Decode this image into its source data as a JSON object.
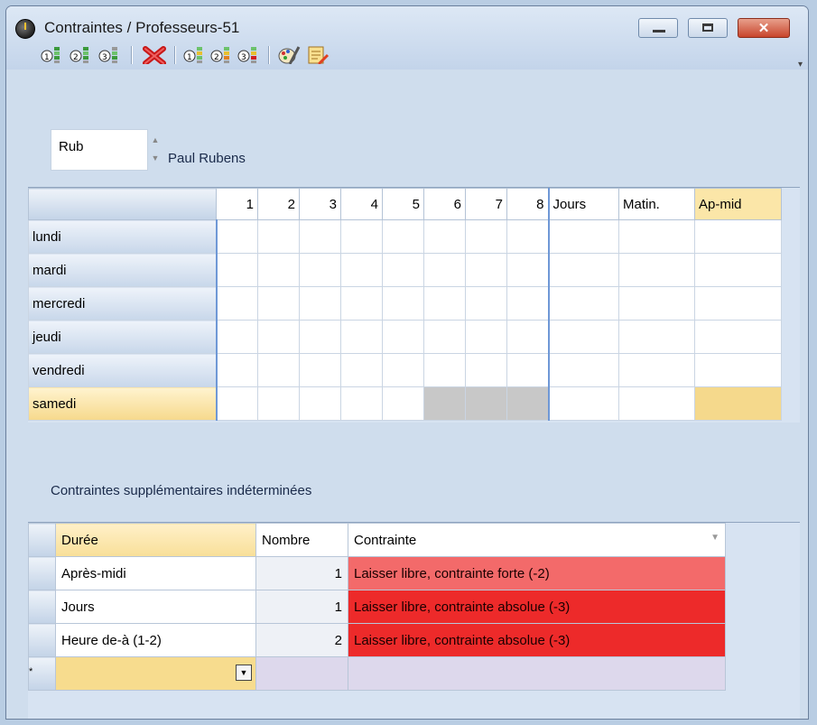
{
  "window": {
    "title": "Contraintes / Professeurs-51"
  },
  "toolbar": {
    "icons": [
      "add-constraint-1-icon",
      "add-constraint-2-icon",
      "add-constraint-3-icon",
      "delete-icon",
      "remove-constraint-1-icon",
      "remove-constraint-2-icon",
      "remove-constraint-3-icon",
      "edit-icon",
      "report-icon"
    ]
  },
  "teacher": {
    "code": "Rub",
    "name": "Paul Rubens"
  },
  "schedule": {
    "columns": [
      "1",
      "2",
      "3",
      "4",
      "5",
      "6",
      "7",
      "8",
      "Jours",
      "Matin.",
      "Ap-mid"
    ],
    "days": [
      "lundi",
      "mardi",
      "mercredi",
      "jeudi",
      "vendredi",
      "samedi"
    ],
    "selected_day": "samedi",
    "selected_column": "Ap-mid"
  },
  "extra": {
    "section_label": "Contraintes supplémentaires indéterminées",
    "headers": {
      "duree": "Durée",
      "nombre": "Nombre",
      "contrainte": "Contrainte"
    },
    "rows": [
      {
        "duree": "Après-midi",
        "nombre": "1",
        "contrainte": "Laisser libre, contrainte forte (-2)"
      },
      {
        "duree": "Jours",
        "nombre": "1",
        "contrainte": "Laisser libre, contrainte absolue (-3)"
      },
      {
        "duree": "Heure de-à (1-2)",
        "nombre": "2",
        "contrainte": "Laisser libre, contrainte absolue (-3)"
      }
    ],
    "new_row_marker": "*"
  },
  "colors": {
    "strong": "#f36a6a",
    "absolute": "#ed2a2a",
    "highlight": "#f5d98c"
  }
}
